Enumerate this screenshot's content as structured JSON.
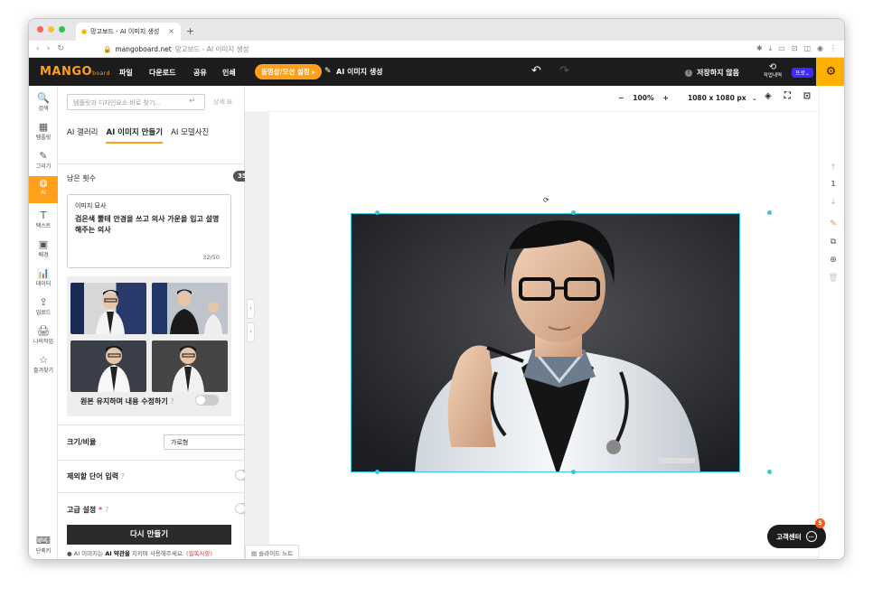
{
  "browser": {
    "tab_title": "망고보드 - AI 이미지 생성",
    "url_domain": "mangoboard.net",
    "url_title": "망고보드 - AI 이미지 생성"
  },
  "app": {
    "logo": "MANGO",
    "logo_sub": "board",
    "menu": [
      "파일",
      "다운로드",
      "공유",
      "인쇄"
    ],
    "motion_button": "동영상/모션 설정 ▸",
    "doc_title": "AI 이미지 생성",
    "save_status": "저장하지 않음",
    "history_label": "작업내역",
    "pro_badge": "프로⌄"
  },
  "leftbar": [
    {
      "icon": "🔍",
      "label": "검색"
    },
    {
      "icon": "▦",
      "label": "템플릿"
    },
    {
      "icon": "✎",
      "label": "그리기"
    },
    {
      "icon": "❂",
      "label": "AI"
    },
    {
      "icon": "T",
      "label": "텍스트"
    },
    {
      "icon": "▣",
      "label": "배경"
    },
    {
      "icon": "📊",
      "label": "데이터"
    },
    {
      "icon": "⇪",
      "label": "업로드"
    },
    {
      "icon": "🖨",
      "label": "나의작업"
    },
    {
      "icon": "☆",
      "label": "즐겨찾기"
    },
    {
      "icon": "⌨",
      "label": "단축키"
    }
  ],
  "panel": {
    "search_placeholder": "템플릿과 디자인요소 바로 찾기...",
    "detail_label": "상세",
    "tabs": [
      "AI 갤러리",
      "AI 이미지 만들기",
      "AI 모델사진"
    ],
    "remaining_label": "남은 횟수",
    "remaining_count": "35/50",
    "desc_label": "이미지 묘사",
    "desc_text": "검은색 뿔테 안경을 쓰고 의사 가운을 입고 설명해주는 의사",
    "desc_count": "32/50",
    "keep_label": "원본 유지하며 내용 수정하기",
    "size_label": "크기/비율",
    "size_value": "가로형",
    "exclude_label": "제외할 단어 입력",
    "advanced_label": "고급 설정",
    "regen_button": "다시 만들기",
    "terms_prefix": "AI 이미지는",
    "terms_bold": "AI 약관을",
    "terms_suffix": "지키며 사용해주세요.",
    "terms_link": "(필독사항)"
  },
  "canvas": {
    "zoom": "100%",
    "dimensions": "1080 x 1080 px",
    "page_number": "1",
    "notes_label": "슬라이드 노트"
  },
  "help": {
    "label": "고객센터",
    "badge": "5"
  }
}
